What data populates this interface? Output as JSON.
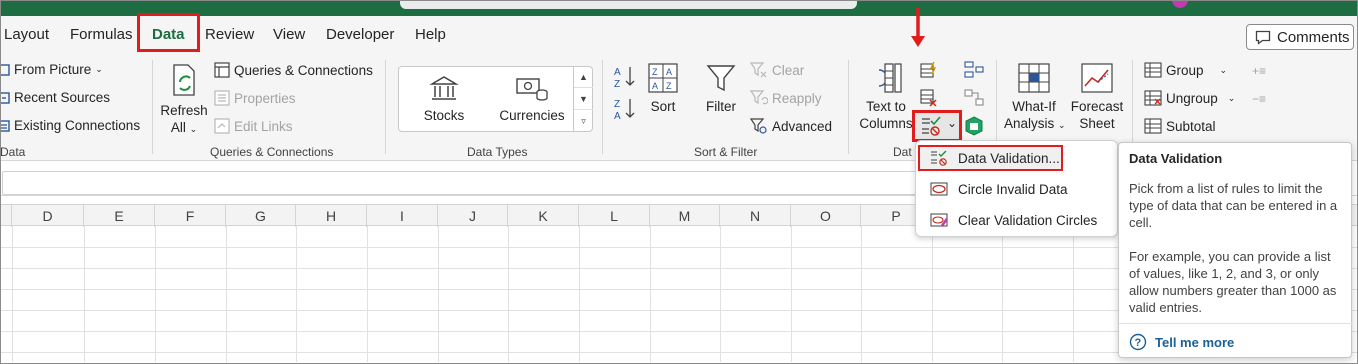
{
  "tabs": [
    "Layout",
    "Formulas",
    "Data",
    "Review",
    "View",
    "Developer",
    "Help"
  ],
  "active_tab": "Data",
  "comments_label": "Comments",
  "get_data": {
    "from_picture": "From Picture",
    "recent_sources": "Recent Sources",
    "existing_connections": "Existing Connections",
    "group_label": "Data"
  },
  "queries": {
    "refresh_line1": "Refresh",
    "refresh_line2": "All",
    "queries_connections": "Queries & Connections",
    "properties": "Properties",
    "edit_links": "Edit Links",
    "group_label": "Queries & Connections"
  },
  "data_types": {
    "stocks": "Stocks",
    "currencies": "Currencies",
    "group_label": "Data Types"
  },
  "sort_filter": {
    "sort": "Sort",
    "filter": "Filter",
    "clear": "Clear",
    "reapply": "Reapply",
    "advanced": "Advanced",
    "group_label": "Sort & Filter"
  },
  "data_tools": {
    "text_to_columns_line1": "Text to",
    "text_to_columns_line2": "Columns",
    "group_label": "Dat"
  },
  "forecast": {
    "what_if_line1": "What-If",
    "what_if_line2": "Analysis",
    "forecast_sheet_line1": "Forecast",
    "forecast_sheet_line2": "Sheet"
  },
  "outline": {
    "group": "Group",
    "ungroup": "Ungroup",
    "subtotal": "Subtotal"
  },
  "columns": [
    "D",
    "E",
    "F",
    "G",
    "H",
    "I",
    "J",
    "K",
    "L",
    "M",
    "N",
    "O",
    "P"
  ],
  "dv_menu": {
    "items": [
      "Data Validation...",
      "Circle Invalid Data",
      "Clear Validation Circles"
    ]
  },
  "tooltip": {
    "title": "Data Validation",
    "p1": "Pick from a list of rules to limit the type of data that can be entered in a cell.",
    "p2": "For example, you can provide a list of values, like 1, 2, and 3, or only allow numbers greater than 1000 as valid entries.",
    "link": "Tell me more"
  },
  "colors": {
    "title_bar": "#1e6c41",
    "highlight_red": "#e21b1b",
    "link_blue": "#1b5f95"
  }
}
